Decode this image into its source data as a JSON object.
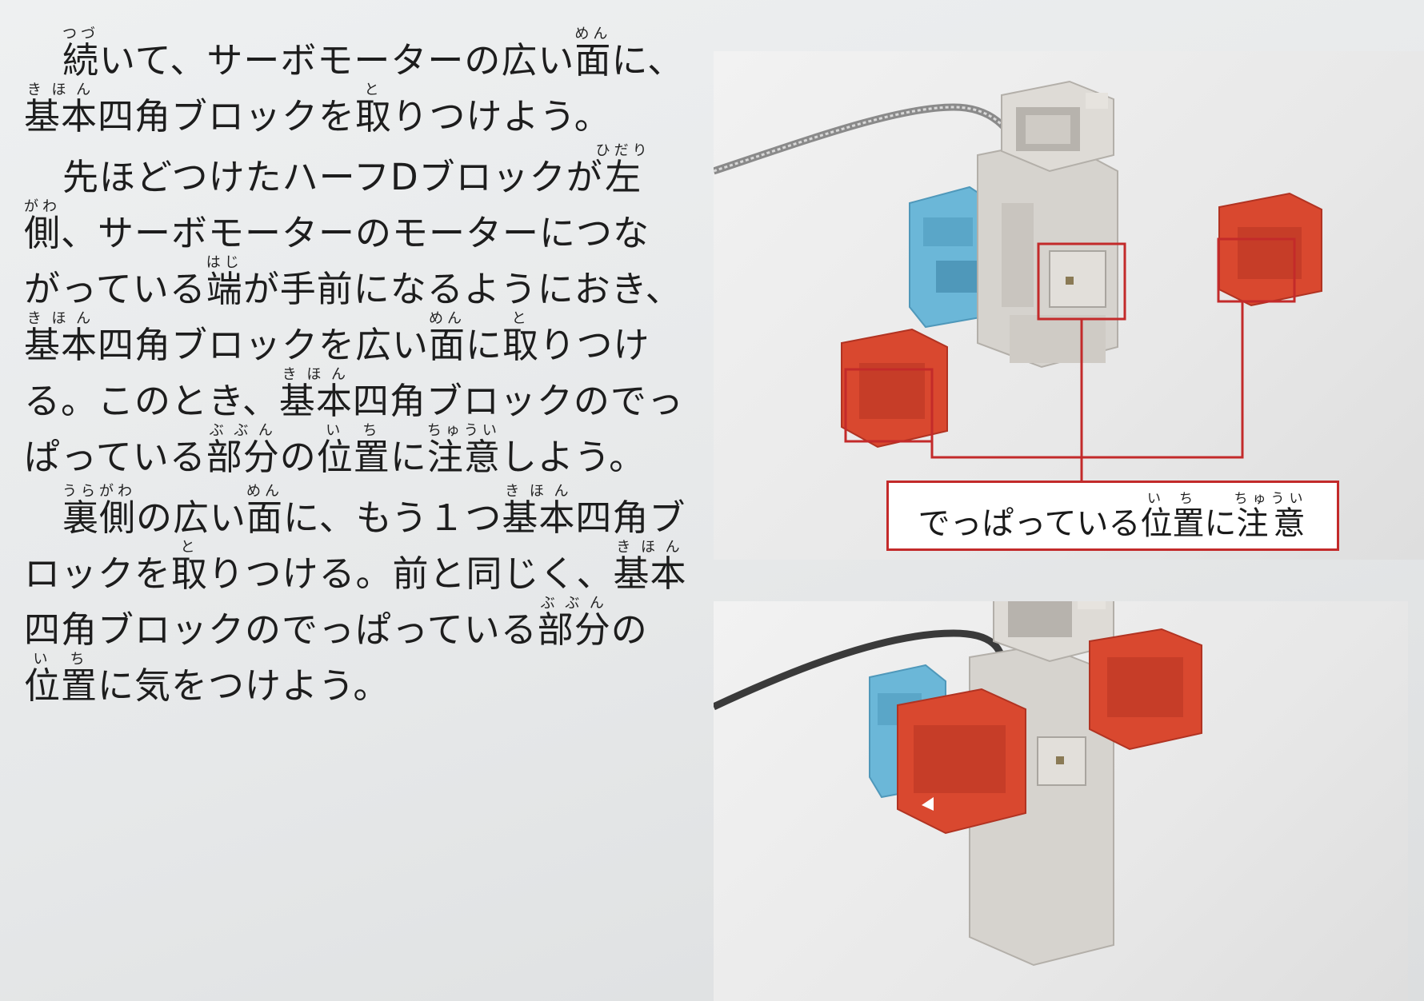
{
  "paragraphs": [
    {
      "lines": [
        {
          "indent": true,
          "parts": [
            {
              "ruby": "続",
              "rt": "つづ"
            },
            {
              "t": "いて、サーボモーターの広い"
            },
            {
              "ruby": "面",
              "rt": "めん"
            },
            {
              "t": "に、"
            }
          ]
        },
        {
          "indent": false,
          "parts": [
            {
              "ruby": "基本",
              "rt": "きほん"
            },
            {
              "t": "四角ブロックを"
            },
            {
              "ruby": "取",
              "rt": "と"
            },
            {
              "t": "りつけよう。"
            }
          ]
        }
      ]
    },
    {
      "lines": [
        {
          "indent": true,
          "parts": [
            {
              "t": "先ほどつけたハーフDブロックが"
            },
            {
              "ruby": "左",
              "rt": "ひだり"
            }
          ]
        },
        {
          "indent": false,
          "parts": [
            {
              "ruby": "側",
              "rt": "がわ"
            },
            {
              "t": "、サーボモーターのモーターにつな"
            }
          ]
        },
        {
          "indent": false,
          "parts": [
            {
              "t": "がっている"
            },
            {
              "ruby": "端",
              "rt": "はじ"
            },
            {
              "t": "が手前になるようにおき、"
            }
          ]
        },
        {
          "indent": false,
          "parts": [
            {
              "ruby": "基本",
              "rt": "きほん"
            },
            {
              "t": "四角ブロックを広い"
            },
            {
              "ruby": "面",
              "rt": "めん"
            },
            {
              "t": "に"
            },
            {
              "ruby": "取",
              "rt": "と"
            },
            {
              "t": "りつけ"
            }
          ]
        },
        {
          "indent": false,
          "parts": [
            {
              "t": "る。このとき、"
            },
            {
              "ruby": "基本",
              "rt": "きほん"
            },
            {
              "t": "四角ブロックのでっ"
            }
          ]
        },
        {
          "indent": false,
          "parts": [
            {
              "t": "ぱっている"
            },
            {
              "ruby": "部分",
              "rt": "ぶぶん"
            },
            {
              "t": "の"
            },
            {
              "ruby": "位置",
              "rt": "いち"
            },
            {
              "t": "に"
            },
            {
              "ruby": "注意",
              "rt": "ちゅうい"
            },
            {
              "t": "しよう。"
            }
          ]
        }
      ]
    },
    {
      "lines": [
        {
          "indent": true,
          "parts": [
            {
              "ruby": "裏側",
              "rt": "うらがわ"
            },
            {
              "t": "の広い"
            },
            {
              "ruby": "面",
              "rt": "めん"
            },
            {
              "t": "に、もう１つ"
            },
            {
              "ruby": "基本",
              "rt": "きほん"
            },
            {
              "t": "四角ブ"
            }
          ]
        },
        {
          "indent": false,
          "parts": [
            {
              "t": "ロックを"
            },
            {
              "ruby": "取",
              "rt": "と"
            },
            {
              "t": "りつける。前と同じく、"
            },
            {
              "ruby": "基本",
              "rt": "きほん"
            }
          ]
        },
        {
          "indent": false,
          "parts": [
            {
              "t": "四角ブロックのでっぱっている"
            },
            {
              "ruby": "部分",
              "rt": "ぶぶん"
            },
            {
              "t": "の"
            }
          ]
        },
        {
          "indent": false,
          "parts": [
            {
              "ruby": "位置",
              "rt": "いち"
            },
            {
              "t": "に気をつけよう。"
            }
          ]
        }
      ]
    }
  ],
  "callout": {
    "parts": [
      {
        "t": "でっぱっている"
      },
      {
        "ruby": "位置",
        "rt": "いち"
      },
      {
        "t": "に"
      },
      {
        "ruby": "注意",
        "rt": "ちゅうい"
      }
    ]
  },
  "colors": {
    "callout_red": "#c32a2a",
    "block_red": "#d9482f",
    "block_blue": "#6bb7d8",
    "servo_gray": "#d6d3ce"
  }
}
